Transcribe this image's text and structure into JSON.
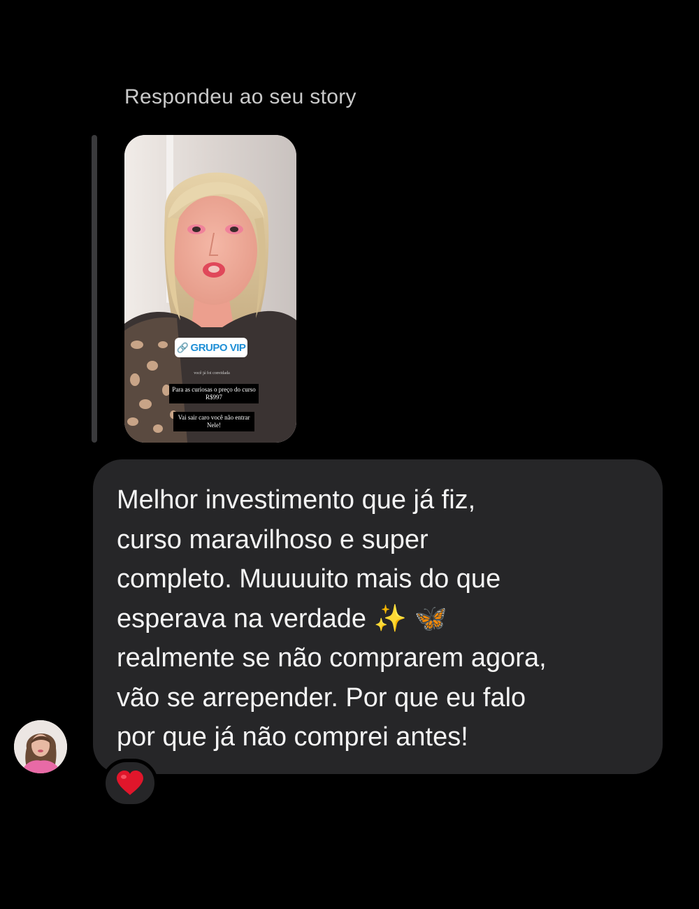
{
  "reply_label": "Respondeu ao seu story",
  "story": {
    "sticker_label": "GRUPO VIP",
    "sticker_icon": "link-icon",
    "small_text": "você já foi convidada",
    "caption_1": "Para as curiosas o preço do curso R$997",
    "caption_2": "Vai sair caro você não entrar Nele!"
  },
  "message": {
    "text": "Melhor investimento que já fiz,\ncurso maravilhoso e super\ncompleto. Muuuuito mais do que\nesperava na verdade ✨ 🦋\nrealmente se não comprarem agora,\nvão se arrepender. Por que eu falo\npor que já não comprei antes!"
  },
  "reaction": {
    "icon": "red-heart-icon",
    "color": "#e0162b"
  },
  "colors": {
    "background": "#000000",
    "bubble": "#262628",
    "reply_label": "#c9c9c9"
  }
}
